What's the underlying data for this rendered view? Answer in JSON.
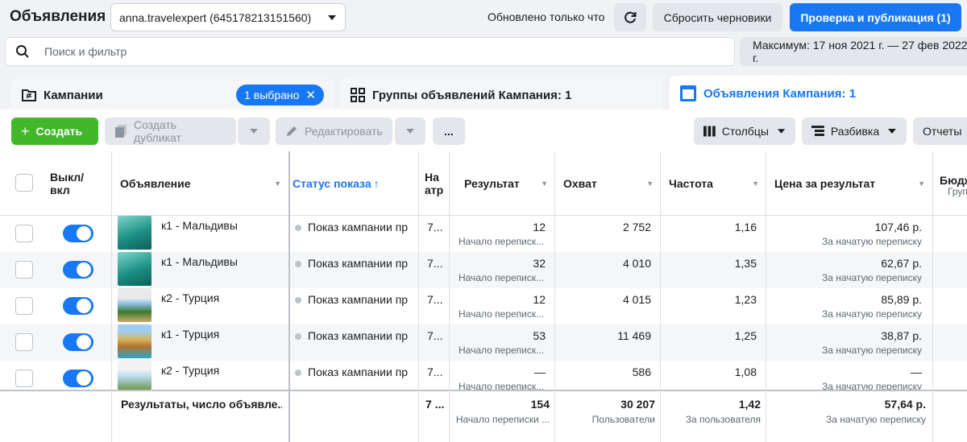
{
  "header": {
    "title": "Объявления",
    "account": "anna.travelexpert (645178213151560)",
    "updated": "Обновлено только что",
    "discard_label": "Сбросить черновики",
    "publish_label": "Проверка и публикация (1)"
  },
  "search": {
    "placeholder": "Поиск и фильтр",
    "date_range": "Максимум: 17 ноя 2021 г. — 27 фев 2022 г."
  },
  "tabs": {
    "campaigns": "Кампании",
    "selected": "1 выбрано",
    "adsets": "Группы объявлений Кампания: 1",
    "ads": "Объявления Кампания: 1"
  },
  "toolbar": {
    "create": "Создать",
    "duplicate": "Создать дубликат",
    "edit": "Редактировать",
    "more": "...",
    "columns": "Столбцы",
    "breakdown": "Разбивка",
    "reports": "Отчеты"
  },
  "table": {
    "columns": {
      "toggle": "Выкл/ вкл",
      "ad": "Объявление",
      "status": "Статус показа",
      "attribution": "На атр",
      "result": "Результат",
      "reach": "Охват",
      "frequency": "Частота",
      "cost": "Цена за результат",
      "budget": "Бюдж",
      "budget_sub": "Груп"
    },
    "rows": [
      {
        "name": "к1 - Мальдивы",
        "status": "Показ кампании пре",
        "attr": "7...",
        "result": "12",
        "result_sub": "Начало переписк...",
        "reach": "2 752",
        "freq": "1,16",
        "cost": "107,46 р.",
        "cost_sub": "За начатую переписку"
      },
      {
        "name": "к1 - Мальдивы",
        "status": "Показ кампании пре",
        "attr": "7...",
        "result": "32",
        "result_sub": "Начало переписк...",
        "reach": "4 010",
        "freq": "1,35",
        "cost": "62,67 р.",
        "cost_sub": "За начатую переписку"
      },
      {
        "name": "к2 - Турция",
        "status": "Показ кампании пре",
        "attr": "7...",
        "result": "12",
        "result_sub": "Начало переписк...",
        "reach": "4 015",
        "freq": "1,23",
        "cost": "85,89 р.",
        "cost_sub": "За начатую переписку"
      },
      {
        "name": "к1 - Турция",
        "status": "Показ кампании пре",
        "attr": "7...",
        "result": "53",
        "result_sub": "Начало переписк...",
        "reach": "11 469",
        "freq": "1,25",
        "cost": "38,87 р.",
        "cost_sub": "За начатую переписку"
      },
      {
        "name": "к2 - Турция",
        "status": "Показ кампании пре",
        "attr": "7...",
        "result": "—",
        "result_sub": "Начало переписк...",
        "reach": "586",
        "freq": "1,08",
        "cost": "—",
        "cost_sub": "За начатую переписку"
      }
    ],
    "totals": {
      "label": "Результаты, число объявле...",
      "attr": "7 ...",
      "result": "154",
      "result_sub": "Начало переписки ...",
      "reach": "30 207",
      "reach_sub": "Пользователи",
      "freq": "1,42",
      "freq_sub": "За пользователя",
      "cost": "57,64 р.",
      "cost_sub": "За начатую переписку"
    }
  },
  "colors": {
    "accent": "#1877f2",
    "create": "#42b72a"
  }
}
